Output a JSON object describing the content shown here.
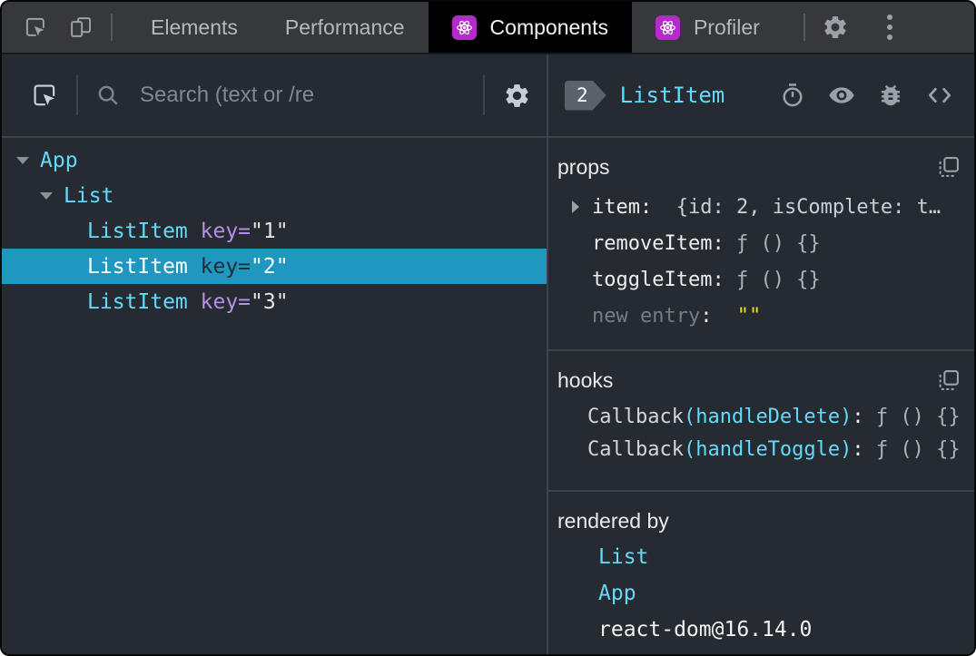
{
  "colors": {
    "accent_cyan": "#61dafb",
    "key_purple": "#b88ee5",
    "selected_row_bg": "#1f97c0",
    "react_icon_bg": "#b32cc9",
    "new_entry_yellow": "#e8e316",
    "badge_bg": "#5b626c",
    "panel_bg": "#262a31",
    "topbar_bg": "#36383b",
    "active_tab_bg": "#000000"
  },
  "icons": {
    "topbar": [
      "inspect-cursor-icon",
      "device-toolbar-icon",
      "react-logo-icon",
      "gear-icon",
      "kebab-menu-icon"
    ],
    "left_toolbar": [
      "inspect-cursor-icon",
      "search-icon",
      "gear-icon"
    ],
    "right_header": [
      "stopwatch-icon",
      "eye-icon",
      "bug-icon",
      "code-brackets-icon"
    ],
    "sections": [
      "copy-icon"
    ]
  },
  "topbar": {
    "tabs": [
      {
        "label": "Elements"
      },
      {
        "label": "Performance"
      },
      {
        "label": "Components"
      },
      {
        "label": "Profiler"
      }
    ]
  },
  "left_panel": {
    "search_placeholder": "Search (text or /re",
    "tree": [
      {
        "name": "App"
      },
      {
        "name": "List"
      },
      {
        "name": "ListItem",
        "attr": "key=",
        "value": "\"1\""
      },
      {
        "name": "ListItem",
        "attr": "key=",
        "value": "\"2\""
      },
      {
        "name": "ListItem",
        "attr": "key=",
        "value": "\"3\""
      }
    ]
  },
  "right_panel": {
    "badge": "2",
    "title": "ListItem",
    "props": {
      "title": "props",
      "rows": [
        {
          "name": "item",
          "colon": ":  ",
          "value": "{id: 2, isComplete: t…"
        },
        {
          "name": "removeItem",
          "colon": ": ",
          "value": "ƒ () {}"
        },
        {
          "name": "toggleItem",
          "colon": ": ",
          "value": "ƒ () {}"
        },
        {
          "name": "new entry",
          "colon": ": ",
          "value": "\"\""
        }
      ]
    },
    "hooks": {
      "title": "hooks",
      "rows": [
        {
          "prefix": "Callback",
          "paren": "(handleDelete)",
          "colon": ": ",
          "value": "ƒ () {}"
        },
        {
          "prefix": "Callback",
          "paren": "(handleToggle)",
          "colon": ": ",
          "value": "ƒ () {}"
        }
      ]
    },
    "rendered_by": {
      "title": "rendered by",
      "links": [
        "List",
        "App"
      ],
      "runtime": "react-dom@16.14.0"
    }
  }
}
